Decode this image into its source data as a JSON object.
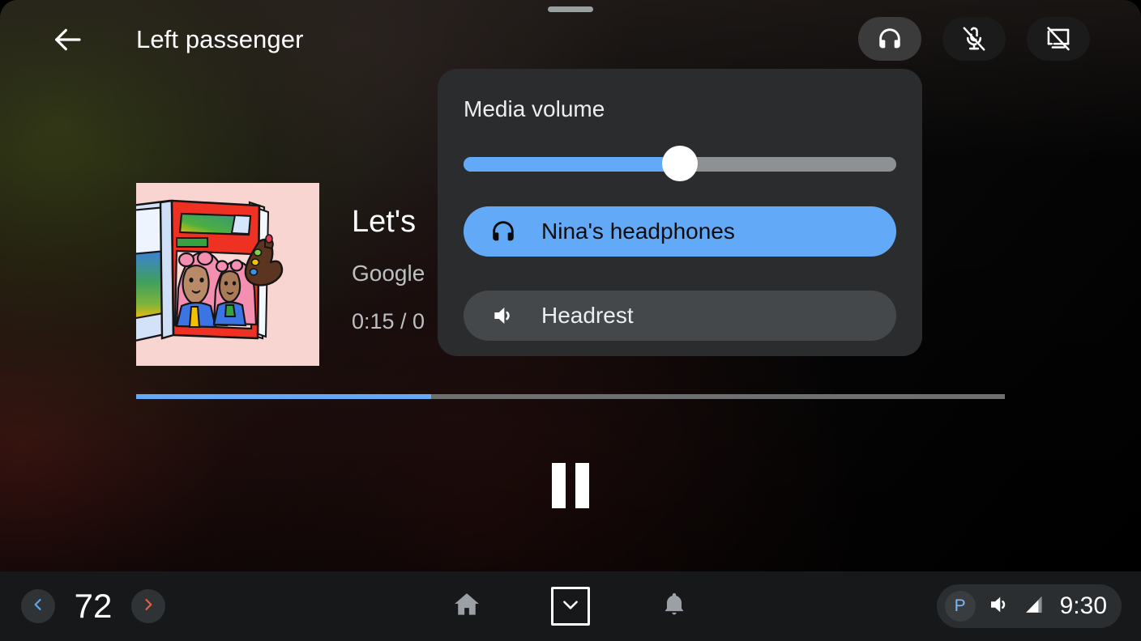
{
  "window": {
    "drag_handle": "drag-handle"
  },
  "topbar": {
    "back_icon": "arrow-left-icon",
    "title": "Left passenger",
    "buttons": [
      {
        "name": "headphones-toggle",
        "icon": "headphones-icon",
        "active": true
      },
      {
        "name": "mic-off-toggle",
        "icon": "mic-off-icon",
        "active": false
      },
      {
        "name": "screen-off-toggle",
        "icon": "screen-off-icon",
        "active": false
      }
    ]
  },
  "now_playing": {
    "album_art_alt": "album-art-two-women-magazine",
    "title": "Let's",
    "artist": "Google",
    "time": "0:15 / 0",
    "progress_percent": 34,
    "transport_icon": "pause-icon"
  },
  "volume_popup": {
    "title": "Media volume",
    "slider": {
      "name": "media-volume-slider",
      "value_percent": 50
    },
    "devices": [
      {
        "label": "Nina's headphones",
        "icon": "headphones-icon",
        "selected": true
      },
      {
        "label": "Headrest",
        "icon": "speaker-volume-icon",
        "selected": false
      }
    ]
  },
  "system_bar": {
    "temperature": {
      "decrease_icon": "chevron-left-icon",
      "value": "72",
      "increase_icon": "chevron-right-icon"
    },
    "nav": [
      {
        "name": "home-button",
        "icon": "home-icon",
        "focused": false
      },
      {
        "name": "app-grid-collapse-button",
        "icon": "chevron-down-icon",
        "focused": true
      },
      {
        "name": "notifications-button",
        "icon": "bell-icon",
        "focused": false
      }
    ],
    "status": {
      "gear_label": "P",
      "volume_icon": "speaker-volume-icon",
      "signal_icon": "signal-bars-icon",
      "clock": "9:30"
    }
  },
  "colors": {
    "accent_blue": "#62aaf8",
    "popup_bg": "#2a2c2e",
    "sysbar_bg": "#16181a",
    "decrease_blue": "#5aa9f0",
    "increase_red": "#e2614a"
  }
}
